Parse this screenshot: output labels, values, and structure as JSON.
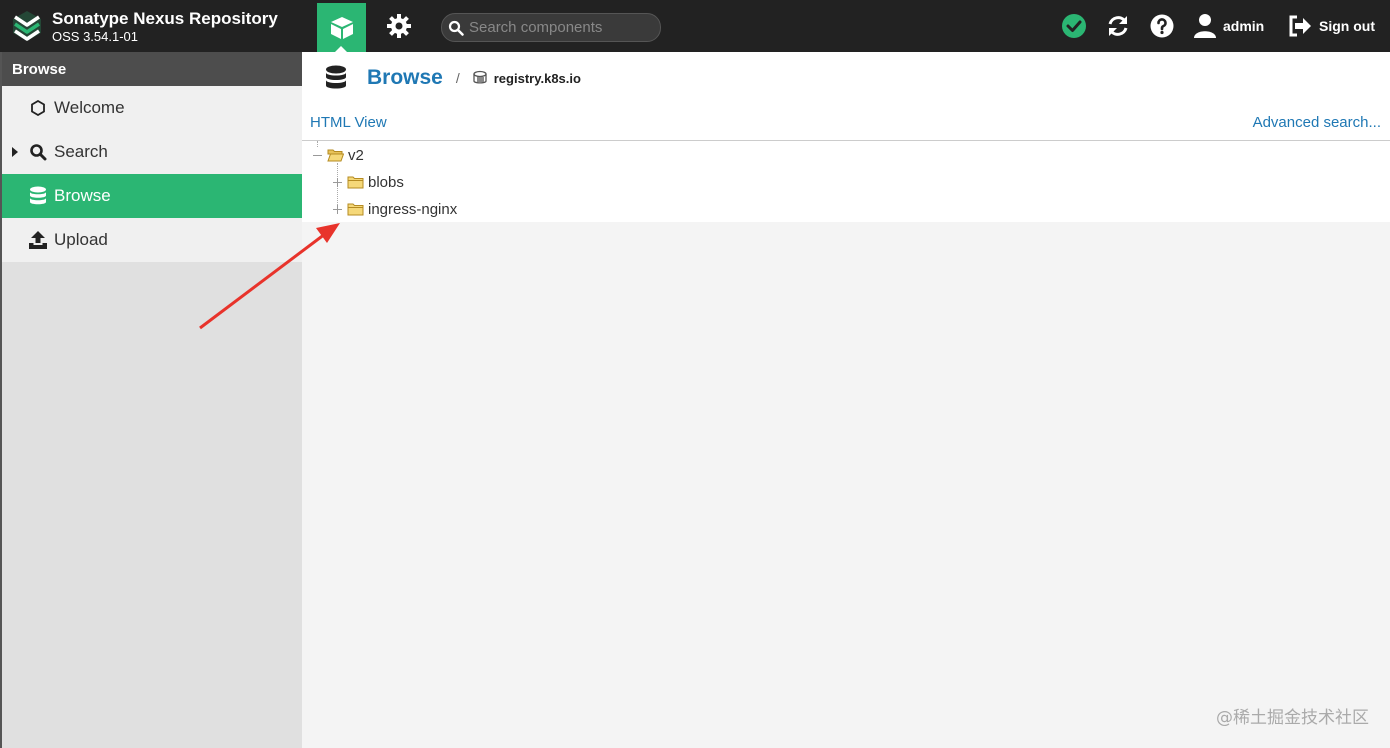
{
  "app": {
    "name": "Sonatype Nexus Repository",
    "version": "OSS 3.54.1-01"
  },
  "header": {
    "search_placeholder": "Search components",
    "user_label": "admin",
    "signout_label": "Sign out",
    "status_color": "#2bb673",
    "accent_color": "#2bb673"
  },
  "sidebar": {
    "title": "Browse",
    "items": [
      {
        "label": "Welcome",
        "icon": "hexagon-icon"
      },
      {
        "label": "Search",
        "icon": "search-icon"
      },
      {
        "label": "Browse",
        "icon": "database-icon",
        "active": true
      },
      {
        "label": "Upload",
        "icon": "upload-icon"
      }
    ]
  },
  "main": {
    "title": "Browse",
    "breadcrumb_sep": "/",
    "repository": "registry.k8s.io",
    "html_view_label": "HTML View",
    "advanced_search_label": "Advanced search...",
    "tree": [
      {
        "label": "v2",
        "expanded": true,
        "children": [
          {
            "label": "blobs",
            "expanded": false
          },
          {
            "label": "ingress-nginx",
            "expanded": false
          }
        ]
      }
    ]
  },
  "watermark": "@稀土掘金技术社区"
}
